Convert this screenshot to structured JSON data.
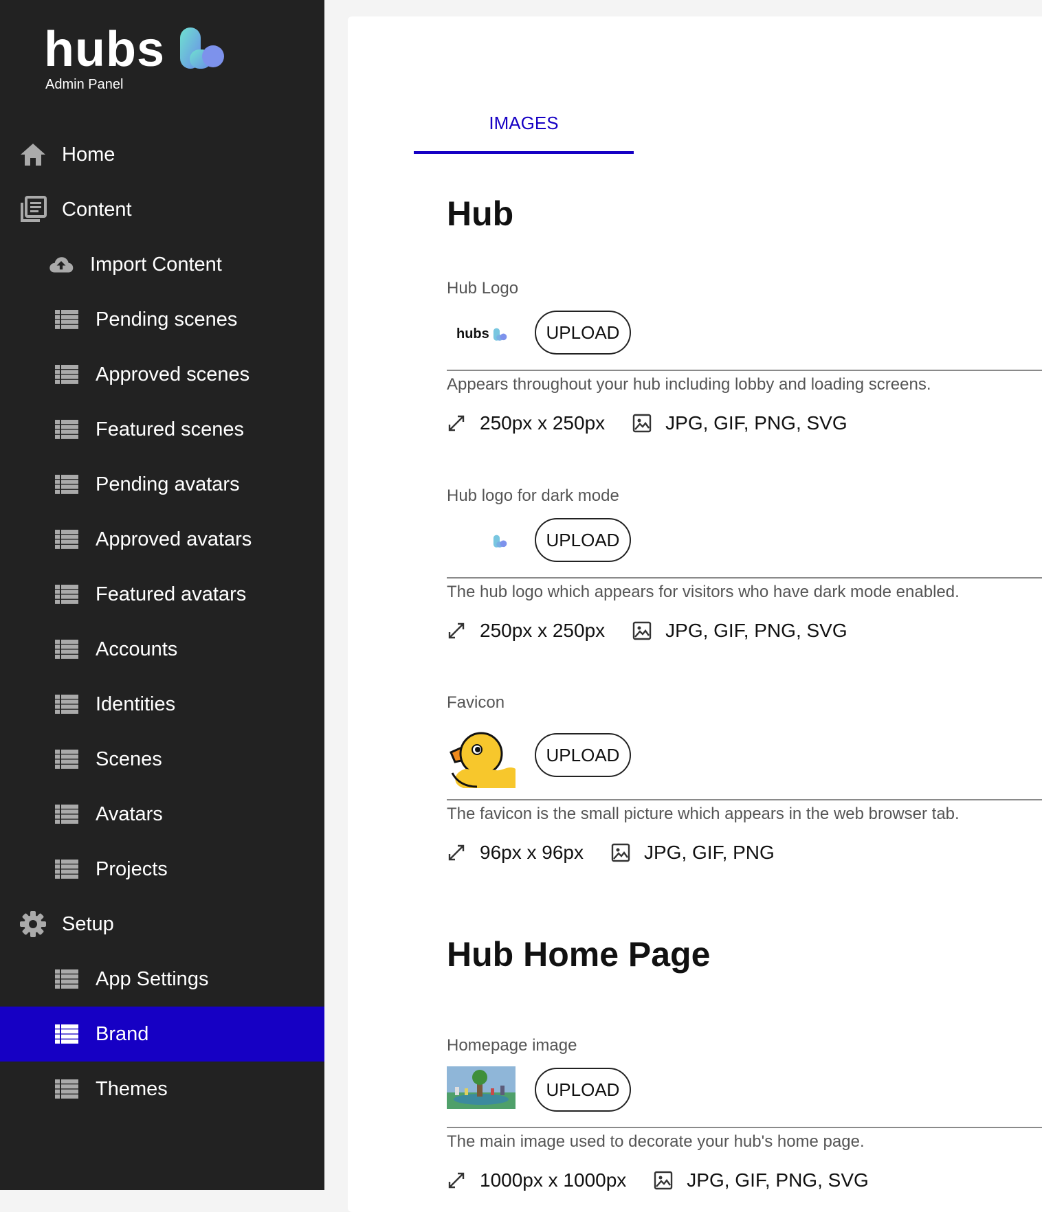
{
  "sidebar": {
    "logo": {
      "word": "hubs",
      "subtitle": "Admin Panel"
    },
    "items": [
      {
        "label": "Home",
        "level": "top",
        "icon": "home-icon"
      },
      {
        "label": "Content",
        "level": "top",
        "icon": "library-icon"
      },
      {
        "label": "Import Content",
        "level": "sub",
        "icon": "cloud-upload-icon"
      },
      {
        "label": "Pending scenes",
        "level": "sub",
        "icon": "list-icon"
      },
      {
        "label": "Approved scenes",
        "level": "sub",
        "icon": "list-icon"
      },
      {
        "label": "Featured scenes",
        "level": "sub",
        "icon": "list-icon"
      },
      {
        "label": "Pending avatars",
        "level": "sub",
        "icon": "list-icon"
      },
      {
        "label": "Approved avatars",
        "level": "sub",
        "icon": "list-icon"
      },
      {
        "label": "Featured avatars",
        "level": "sub",
        "icon": "list-icon"
      },
      {
        "label": "Accounts",
        "level": "sub",
        "icon": "list-icon"
      },
      {
        "label": "Identities",
        "level": "sub",
        "icon": "list-icon"
      },
      {
        "label": "Scenes",
        "level": "sub",
        "icon": "list-icon"
      },
      {
        "label": "Avatars",
        "level": "sub",
        "icon": "list-icon"
      },
      {
        "label": "Projects",
        "level": "sub",
        "icon": "list-icon"
      },
      {
        "label": "Setup",
        "level": "top",
        "icon": "gear-icon"
      },
      {
        "label": "App Settings",
        "level": "sub",
        "icon": "list-icon"
      },
      {
        "label": "Brand",
        "level": "sub",
        "icon": "list-icon",
        "active": true
      },
      {
        "label": "Themes",
        "level": "sub",
        "icon": "list-icon"
      }
    ]
  },
  "main": {
    "tab": "IMAGES",
    "sections": [
      {
        "title": "Hub",
        "fields": [
          {
            "label": "Hub Logo",
            "button": "UPLOAD",
            "description": "Appears throughout your hub including lobby and loading screens.",
            "size": "250px x 250px",
            "formats": "JPG, GIF, PNG, SVG",
            "preview_text": "hubs"
          },
          {
            "label": "Hub logo for dark mode",
            "button": "UPLOAD",
            "description": "The hub logo which appears for visitors who have dark mode enabled.",
            "size": "250px x 250px",
            "formats": "JPG, GIF, PNG, SVG"
          },
          {
            "label": "Favicon",
            "button": "UPLOAD",
            "description": "The favicon is the small picture which appears in the web browser tab.",
            "size": "96px x 96px",
            "formats": "JPG, GIF, PNG"
          }
        ]
      },
      {
        "title": "Hub Home Page",
        "fields": [
          {
            "label": "Homepage image",
            "button": "UPLOAD",
            "description": "The main image used to decorate your hub's home page.",
            "size": "1000px x 1000px",
            "formats": "JPG, GIF, PNG, SVG"
          }
        ]
      }
    ]
  },
  "colors": {
    "sidebar_bg": "#222222",
    "accent": "#1600c4",
    "card_bg": "#ffffff"
  }
}
